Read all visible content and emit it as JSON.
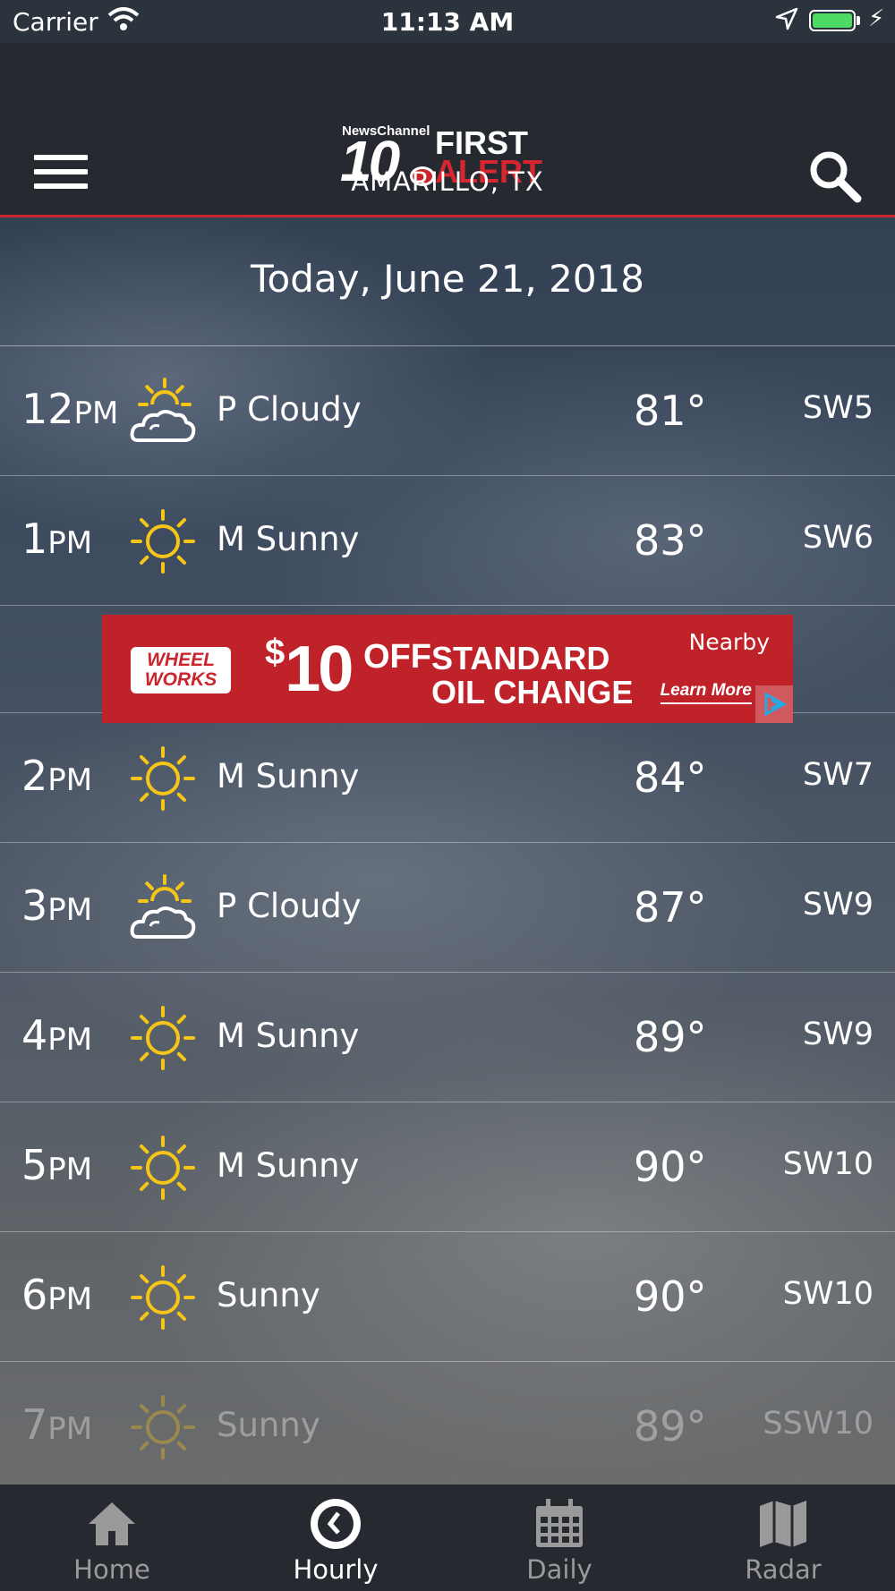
{
  "status_bar": {
    "carrier": "Carrier",
    "time": "11:13 AM",
    "battery_color": "#4cd964"
  },
  "header": {
    "logo": {
      "newschannel": "NewsChannel",
      "number": "10",
      "first": "FIRST",
      "alert": "ALERT"
    },
    "location": "AMARILLO, TX",
    "accent_color": "#c9252c",
    "menu_icon": "hamburger-menu-icon",
    "search_icon": "search-icon"
  },
  "date_label": "Today, June 21, 2018",
  "hours": [
    {
      "hour": "12",
      "period": "PM",
      "icon": "partly-cloudy-icon",
      "condition": "P Cloudy",
      "temp": "81°",
      "wind": "SW5"
    },
    {
      "hour": "1",
      "period": "PM",
      "icon": "sun-icon",
      "condition": "M Sunny",
      "temp": "83°",
      "wind": "SW6"
    },
    {
      "hour": "2",
      "period": "PM",
      "icon": "sun-icon",
      "condition": "M Sunny",
      "temp": "84°",
      "wind": "SW7"
    },
    {
      "hour": "3",
      "period": "PM",
      "icon": "partly-cloudy-icon",
      "condition": "P Cloudy",
      "temp": "87°",
      "wind": "SW9"
    },
    {
      "hour": "4",
      "period": "PM",
      "icon": "sun-icon",
      "condition": "M Sunny",
      "temp": "89°",
      "wind": "SW9"
    },
    {
      "hour": "5",
      "period": "PM",
      "icon": "sun-icon",
      "condition": "M Sunny",
      "temp": "90°",
      "wind": "SW10"
    },
    {
      "hour": "6",
      "period": "PM",
      "icon": "sun-icon",
      "condition": "Sunny",
      "temp": "90°",
      "wind": "SW10"
    },
    {
      "hour": "7",
      "period": "PM",
      "icon": "sun-icon",
      "condition": "Sunny",
      "temp": "89°",
      "wind": "SSW10"
    }
  ],
  "ad": {
    "brand_line1": "WHEEL",
    "brand_line2": "WORKS",
    "dollar": "$",
    "amount": "10",
    "off": "OFF",
    "line1": "STANDARD",
    "line2": "OIL CHANGE",
    "nearby": "Nearby",
    "cta": "Learn More",
    "color": "#bf2229"
  },
  "tabs": [
    {
      "label": "Home",
      "icon": "home-icon"
    },
    {
      "label": "Hourly",
      "icon": "clock-icon",
      "active": true
    },
    {
      "label": "Daily",
      "icon": "calendar-icon"
    },
    {
      "label": "Radar",
      "icon": "map-icon"
    }
  ]
}
